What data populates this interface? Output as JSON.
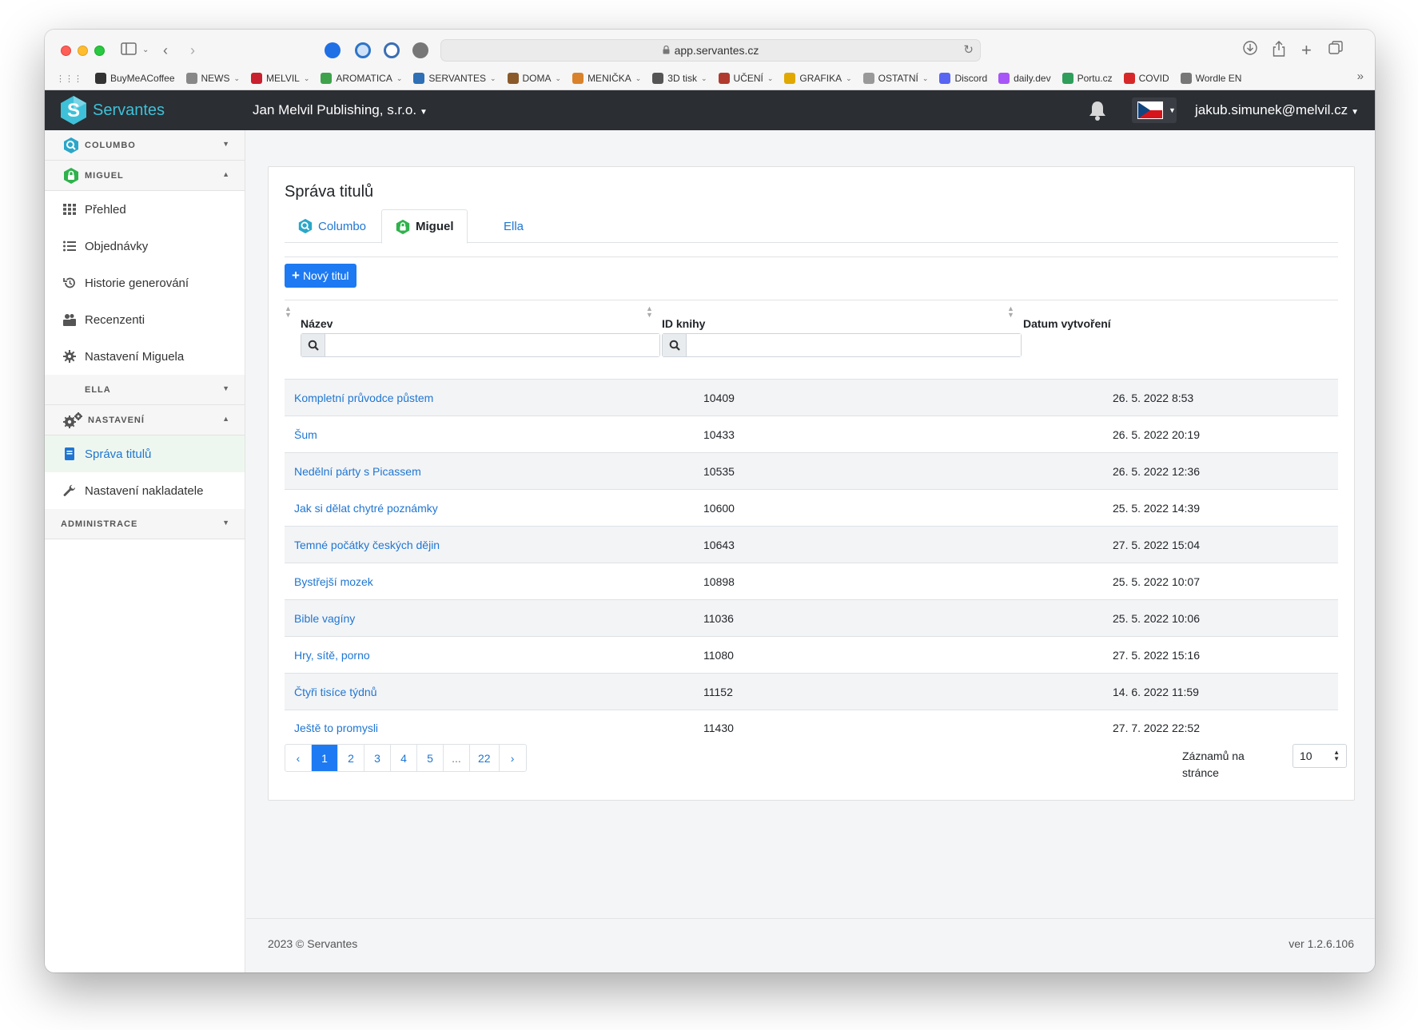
{
  "browser": {
    "url": "app.servantes.cz",
    "bookmarks": [
      {
        "label": "BuyMeACoffee",
        "dropdown": false,
        "color": "#333333"
      },
      {
        "label": "NEWS",
        "dropdown": true,
        "color": "#888888"
      },
      {
        "label": "MELVIL",
        "dropdown": true,
        "color": "#c8202f"
      },
      {
        "label": "AROMATICA",
        "dropdown": true,
        "color": "#3ea24a"
      },
      {
        "label": "SERVANTES",
        "dropdown": true,
        "color": "#2e6fb5"
      },
      {
        "label": "DOMA",
        "dropdown": true,
        "color": "#8b5a2b"
      },
      {
        "label": "MENIČKA",
        "dropdown": true,
        "color": "#d9822b"
      },
      {
        "label": "3D tisk",
        "dropdown": true,
        "color": "#555555"
      },
      {
        "label": "UČENÍ",
        "dropdown": true,
        "color": "#b03a2e"
      },
      {
        "label": "GRAFIKA",
        "dropdown": true,
        "color": "#e0a800"
      },
      {
        "label": "OSTATNÍ",
        "dropdown": true,
        "color": "#999999"
      },
      {
        "label": "Discord",
        "dropdown": false,
        "color": "#5865f2"
      },
      {
        "label": "daily.dev",
        "dropdown": false,
        "color": "#a855f7"
      },
      {
        "label": "Portu.cz",
        "dropdown": false,
        "color": "#2f9e5b"
      },
      {
        "label": "COVID",
        "dropdown": false,
        "color": "#d62828"
      },
      {
        "label": "Wordle EN",
        "dropdown": false,
        "color": "#777777"
      }
    ]
  },
  "header": {
    "brand": "Servantes",
    "company": "Jan Melvil Publishing, s.r.o.",
    "user": "jakub.simunek@melvil.cz"
  },
  "sidebar": {
    "columbo": "COLUMBO",
    "miguel": "MIGUEL",
    "miguel_items": [
      {
        "label": "Přehled",
        "icon": "grid-icon"
      },
      {
        "label": "Objednávky",
        "icon": "list-icon"
      },
      {
        "label": "Historie generování",
        "icon": "history-icon"
      },
      {
        "label": "Recenzenti",
        "icon": "reviewers-icon"
      },
      {
        "label": "Nastavení Miguela",
        "icon": "gear-icon"
      }
    ],
    "ella": "ELLA",
    "nastaveni": "NASTAVENÍ",
    "settings_items": [
      {
        "label": "Správa titulů",
        "icon": "book-icon",
        "active": true
      },
      {
        "label": "Nastavení nakladatele",
        "icon": "wrench-icon",
        "active": false
      }
    ],
    "administrace": "ADMINISTRACE"
  },
  "main": {
    "title": "Správa titulů",
    "tabs": [
      {
        "label": "Columbo",
        "active": false
      },
      {
        "label": "Miguel",
        "active": true
      },
      {
        "label": "Ella",
        "active": false
      }
    ],
    "new_button": "Nový titul",
    "columns": {
      "name": "Název",
      "id": "ID knihy",
      "date": "Datum vytvoření"
    },
    "filters": {
      "name": "",
      "id": ""
    },
    "rows": [
      {
        "name": "Kompletní průvodce půstem",
        "id": "10409",
        "date": "26. 5. 2022 8:53"
      },
      {
        "name": "Šum",
        "id": "10433",
        "date": "26. 5. 2022 20:19"
      },
      {
        "name": "Nedělní párty s Picassem",
        "id": "10535",
        "date": "26. 5. 2022 12:36"
      },
      {
        "name": "Jak si dělat chytré poznámky",
        "id": "10600",
        "date": "25. 5. 2022 14:39"
      },
      {
        "name": "Temné počátky českých dějin",
        "id": "10643",
        "date": "27. 5. 2022 15:04"
      },
      {
        "name": "Bystřejší mozek",
        "id": "10898",
        "date": "25. 5. 2022 10:07"
      },
      {
        "name": "Bible vagíny",
        "id": "11036",
        "date": "25. 5. 2022 10:06"
      },
      {
        "name": "Hry, sítě, porno",
        "id": "11080",
        "date": "27. 5. 2022 15:16"
      },
      {
        "name": "Čtyři tisíce týdnů",
        "id": "11152",
        "date": "14. 6. 2022 11:59"
      },
      {
        "name": "Ještě to promysli",
        "id": "11430",
        "date": "27. 7. 2022 22:52"
      }
    ],
    "pagination": {
      "prev": "‹",
      "pages": [
        "1",
        "2",
        "3",
        "4",
        "5",
        "...",
        "22"
      ],
      "active": "1",
      "next": "›"
    },
    "per_page_label": "Záznamů na stránce",
    "per_page_value": "10"
  },
  "footer": {
    "copyright": "2023 © Servantes",
    "version": "ver 1.2.6.106"
  },
  "colors": {
    "navbar": "#2b2e33",
    "link": "#1f76d2",
    "primary": "#1d7af2",
    "columbo": "#2aa7c9",
    "miguel": "#2fb24c"
  }
}
